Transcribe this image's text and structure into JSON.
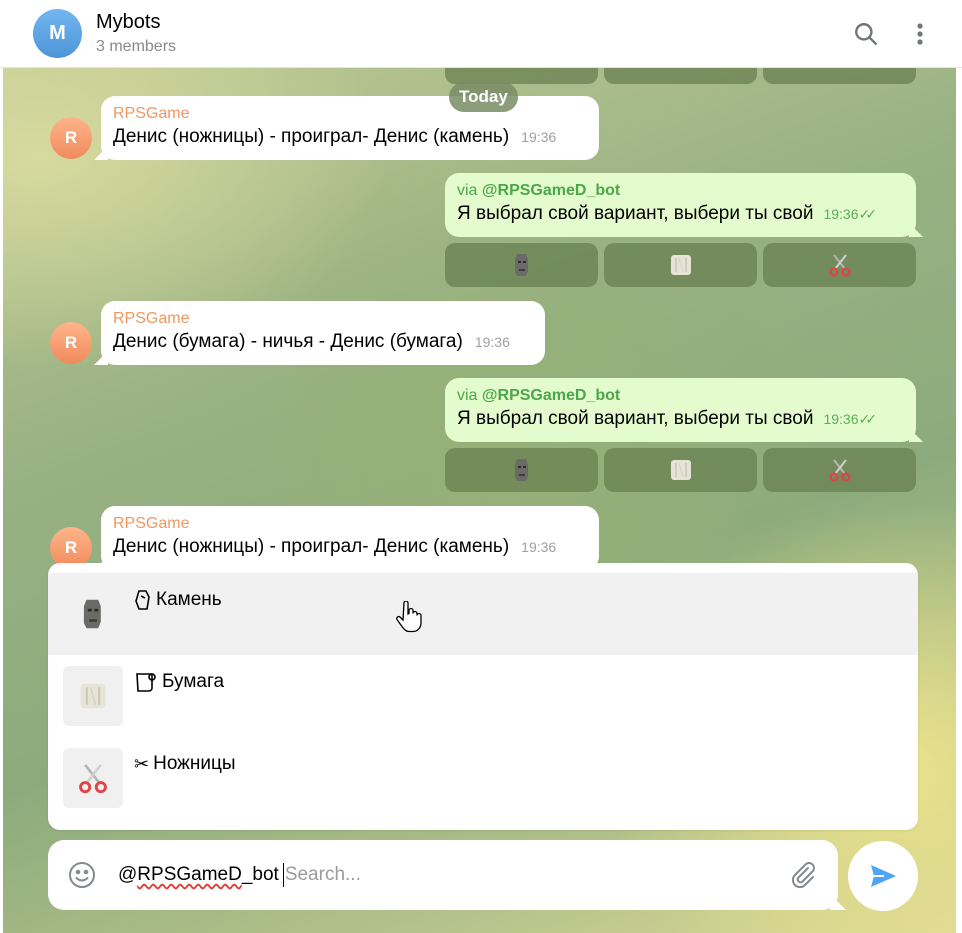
{
  "header": {
    "avatar_letter": "M",
    "title": "Mybots",
    "subtitle": "3 members",
    "search_icon": "search-icon",
    "menu_icon": "more-vertical-icon"
  },
  "date_separator": "Today",
  "messages": [
    {
      "direction": "in",
      "avatar_letter": "R",
      "sender": "RPSGame",
      "text": "Денис (ножницы) - проиграл- Денис (камень)",
      "time": "19:36"
    },
    {
      "direction": "out",
      "via_prefix": "via ",
      "via_bot": "@RPSGameD_bot",
      "text": "Я выбрал свой вариант, выбери ты свой",
      "time": "19:36",
      "status": "read",
      "buttons": [
        "moai-icon",
        "toilet-paper-icon",
        "scissors-icon"
      ]
    },
    {
      "direction": "in",
      "avatar_letter": "R",
      "sender": "RPSGame",
      "text": "Денис (бумага) - ничья - Денис (бумага)",
      "time": "19:36"
    },
    {
      "direction": "out",
      "via_prefix": "via ",
      "via_bot": "@RPSGameD_bot",
      "text": "Я выбрал свой вариант, выбери ты свой",
      "time": "19:36",
      "status": "read",
      "buttons": [
        "moai-icon",
        "toilet-paper-icon",
        "scissors-icon"
      ]
    },
    {
      "direction": "in",
      "avatar_letter": "R",
      "sender": "RPSGame",
      "text": "Денис (ножницы) - проиграл- Денис (камень)",
      "time": "19:36"
    }
  ],
  "inline_results": [
    {
      "icon": "rock-icon",
      "thumb": "moai-icon",
      "label": "Камень",
      "highlighted": true
    },
    {
      "icon": "paper-icon",
      "thumb": "toilet-paper-icon",
      "label": "Бумага",
      "highlighted": false
    },
    {
      "icon": "scissors-icon",
      "thumb": "scissors-icon",
      "label": "Ножницы",
      "highlighted": false
    }
  ],
  "composer": {
    "value": "@RPSGameD_bot ",
    "placeholder": "Search...",
    "emoji_icon": "smile-icon",
    "attach_icon": "paperclip-icon",
    "send_icon": "send-icon"
  },
  "colors": {
    "accent": "#4ea4f6",
    "sender_name": "#f0975f",
    "outgoing_bubble": "#e4fccd",
    "via_text": "#4ca64a"
  }
}
